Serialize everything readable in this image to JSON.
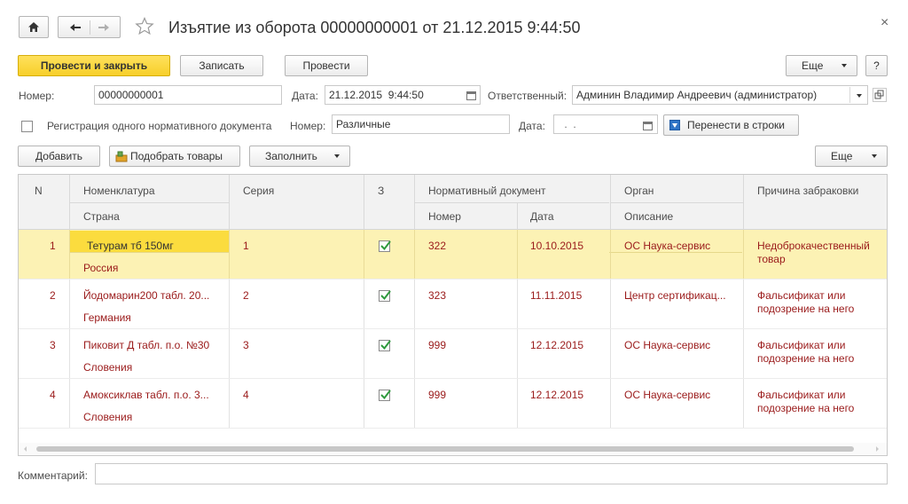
{
  "window": {
    "title": "Изъятие из оборота 00000000001 от 21.12.2015 9:44:50",
    "close": "×"
  },
  "toolbar": {
    "post_and_close": "Провести и закрыть",
    "save": "Записать",
    "post": "Провести",
    "more": "Еще",
    "help": "?"
  },
  "form": {
    "number_label": "Номер:",
    "number_value": "00000000001",
    "date_label": "Дата:",
    "date_value": "21.12.2015  9:44:50",
    "responsible_label": "Ответственный:",
    "responsible_value": "Админин Владимир Андреевич (администратор)",
    "single_doc_label": "Регистрация одного нормативного документа",
    "doc_number_label": "Номер:",
    "doc_number_value": "Различные",
    "doc_date_label": "Дата:",
    "doc_date_value": " .  .",
    "move_to_rows": "Перенести в строки"
  },
  "table_toolbar": {
    "add": "Добавить",
    "pick_goods": "Подобрать товары",
    "fill": "Заполнить",
    "more": "Еще"
  },
  "columns": {
    "n": "N",
    "nomenclature": "Номенклатура",
    "country": "Страна",
    "series": "Серия",
    "z": "З",
    "norm_doc": "Нормативный документ",
    "number": "Номер",
    "date": "Дата",
    "organ": "Орган",
    "description": "Описание",
    "reason": "Причина забраковки"
  },
  "rows": [
    {
      "n": "1",
      "name": "Тетурам тб 150мг",
      "country": "Россия",
      "series": "1",
      "checked": true,
      "number": "322",
      "date": "10.10.2015",
      "organ": "ОС Наука-сервис",
      "description": "",
      "reason": "Недоброкачественный товар"
    },
    {
      "n": "2",
      "name": "Йодомарин200 табл. 20...",
      "country": "Германия",
      "series": "2",
      "checked": true,
      "number": "323",
      "date": "11.11.2015",
      "organ": "Центр сертификац...",
      "description": "",
      "reason": "Фальсификат или подозрение на него"
    },
    {
      "n": "3",
      "name": "Пиковит Д табл. п.о. №30",
      "country": "Словения",
      "series": "3",
      "checked": true,
      "number": "999",
      "date": "12.12.2015",
      "organ": "ОС Наука-сервис",
      "description": "",
      "reason": "Фальсификат или подозрение на него"
    },
    {
      "n": "4",
      "name": "Амоксиклав табл. п.о. 3...",
      "country": "Словения",
      "series": "4",
      "checked": true,
      "number": "999",
      "date": "12.12.2015",
      "organ": "ОС Наука-сервис",
      "description": "",
      "reason": "Фальсификат или подозрение на него"
    }
  ],
  "comment_label": "Комментарий:",
  "comment_value": "",
  "colors": {
    "primary_button": "#f7cf2a",
    "selected_row": "#fcf2b4",
    "selected_cell": "#fbdc3e",
    "row_text": "#9a1a1a",
    "check": "#2e9a3d"
  }
}
